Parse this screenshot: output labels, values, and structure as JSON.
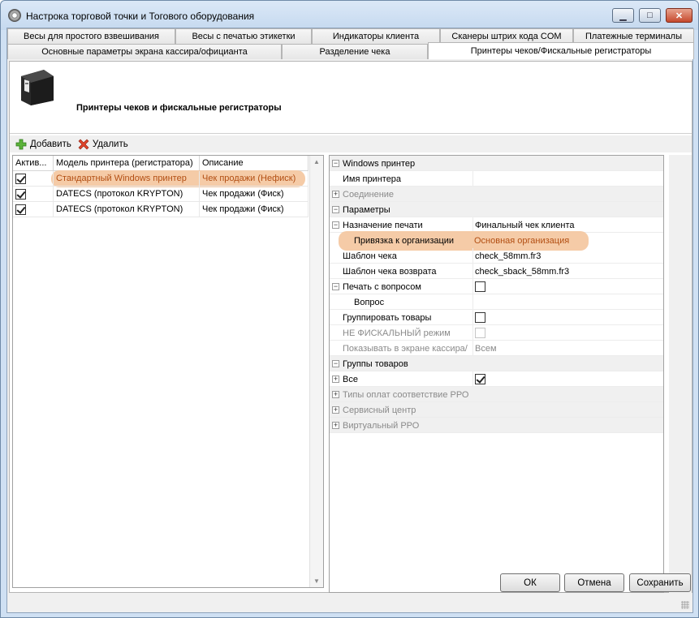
{
  "window": {
    "title": "Настрока торговой точки и Тогового оборудования",
    "min": "▁",
    "max": "□",
    "close": "✕"
  },
  "tabs": {
    "row1": [
      "Весы для простого взвешивания",
      "Весы с печатью этикетки",
      "Индикаторы клиента",
      "Сканеры штрих кода COM",
      "Платежные терминалы"
    ],
    "row2": [
      "Основные параметры экрана кассира/официанта",
      "Разделение чека",
      "Принтеры чеков/Фискальные регистраторы"
    ],
    "active": "Принтеры чеков/Фискальные регистраторы"
  },
  "header": {
    "title": "Принтеры чеков и фискальные регистраторы",
    "icon": "receipt-printer-icon"
  },
  "toolbar": {
    "add_label": "Добавить",
    "delete_label": "Удалить"
  },
  "printers_grid": {
    "columns": [
      "Актив...",
      "Модель принтера (регистратора)",
      "Описание"
    ],
    "rows": [
      {
        "active": true,
        "model": "Стандартный Windows принтер",
        "description": "Чек продажи (Нефиск)",
        "selected": true
      },
      {
        "active": true,
        "model": "DATECS (протокол KRYPTON)",
        "description": "Чек продажи (Фиск)"
      },
      {
        "active": true,
        "model": "DATECS (протокол KRYPTON)",
        "description": "Чек продажи (Фиск)"
      }
    ]
  },
  "properties": {
    "windows_printer": "Windows принтер",
    "printer_name": "Имя принтера",
    "printer_name_value": "",
    "connection": "Соединение",
    "params": "Параметры",
    "print_purpose": "Назначение печати",
    "print_purpose_value": "Финальный чек клиента",
    "org_binding": "Привязка к организации",
    "org_binding_value": "Основная организация",
    "receipt_template": "Шаблон чека",
    "receipt_template_value": "check_58mm.fr3",
    "return_template": "Шаблон чека возврата",
    "return_template_value": "check_sback_58mm.fr3",
    "print_with_question": "Печать с вопросом",
    "question": "Вопрос",
    "group_goods": "Группировать товары",
    "non_fiscal": "НЕ ФИСКАЛЬНЫЙ режим",
    "show_on_cashier": "Показывать в экране кассира/",
    "show_on_cashier_value": "Всем",
    "goods_groups": "Группы товаров",
    "all": "Все",
    "payment_types": "Типы оплат соответствие РРО",
    "service_center": "Сервисный центр",
    "virtual_rro": "Виртуальный РРО"
  },
  "footer": {
    "ok": "ОК",
    "cancel": "Отмена",
    "save": "Сохранить"
  },
  "colors": {
    "highlight": "#f4c8a2",
    "title_bar": "#c5d9ef",
    "close_button": "#c6492d"
  }
}
